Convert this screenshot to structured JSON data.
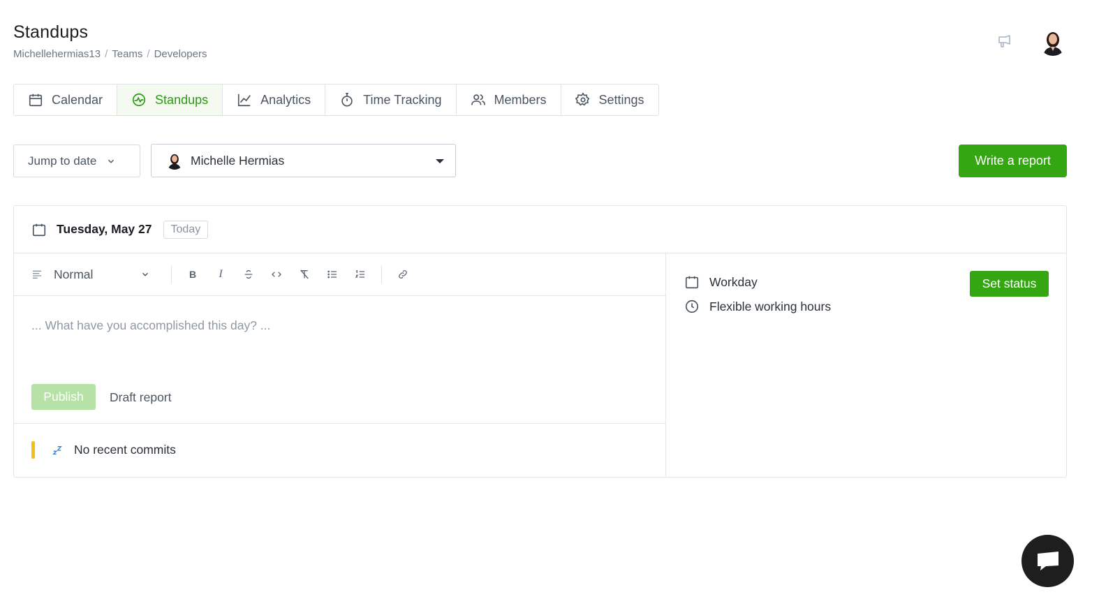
{
  "page": {
    "title": "Standups",
    "breadcrumb": [
      "Michellehermias13",
      "Teams",
      "Developers"
    ]
  },
  "header": {
    "announce_icon": "megaphone-icon",
    "avatar": "user-avatar"
  },
  "tabs": [
    {
      "label": "Calendar",
      "icon": "calendar-icon",
      "active": false
    },
    {
      "label": "Standups",
      "icon": "standup-pulse-icon",
      "active": true
    },
    {
      "label": "Analytics",
      "icon": "chart-line-icon",
      "active": false
    },
    {
      "label": "Time Tracking",
      "icon": "stopwatch-icon",
      "active": false
    },
    {
      "label": "Members",
      "icon": "users-icon",
      "active": false
    },
    {
      "label": "Settings",
      "icon": "gear-icon",
      "active": false
    }
  ],
  "controls": {
    "jump_label": "Jump to date",
    "user_name": "Michelle Hermias",
    "write_report_label": "Write a report"
  },
  "report": {
    "date": "Tuesday, May 27",
    "today_label": "Today",
    "format_value": "Normal",
    "toolbar": [
      "bold",
      "italic",
      "strikethrough",
      "code",
      "clear-format",
      "bullet-list",
      "numbered-list",
      "link"
    ],
    "placeholder": "... What have you accomplished this day? ...",
    "publish_label": "Publish",
    "draft_label": "Draft report",
    "commits_label": "No recent commits"
  },
  "status": {
    "day_type": "Workday",
    "hours": "Flexible working hours",
    "set_status_label": "Set status"
  },
  "colors": {
    "accent": "#33a612",
    "accent_disabled": "#b6e2a8",
    "commit_bar": "#f5bf10"
  }
}
